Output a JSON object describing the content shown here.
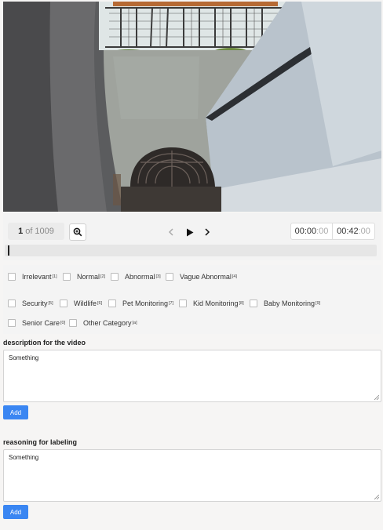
{
  "video": {
    "description_alt": ""
  },
  "player": {
    "current_frame": "1",
    "of_label": "of",
    "total_frames": "1009",
    "zoom_icon": "zoom-in-icon",
    "prev_icon": "chevron-left-icon",
    "play_icon": "play-icon",
    "next_icon": "chevron-right-icon",
    "current_time_main": "00:00",
    "current_time_sub": ":00",
    "duration_main": "00:42",
    "duration_sub": ":00",
    "progress": 0.0
  },
  "categories": [
    {
      "label": "Irrelevant",
      "key": "[1]"
    },
    {
      "label": "Normal",
      "key": "[2]"
    },
    {
      "label": "Abnormal",
      "key": "[3]"
    },
    {
      "label": "Vague Abnormal",
      "key": "[4]"
    },
    {
      "label": "Security",
      "key": "[5]"
    },
    {
      "label": "Wildlife",
      "key": "[6]"
    },
    {
      "label": "Pet Monitoring",
      "key": "[7]"
    },
    {
      "label": "Kid Monitoring",
      "key": "[8]"
    },
    {
      "label": "Baby Monitoring",
      "key": "[9]"
    },
    {
      "label": "Senior Care",
      "key": "[0]"
    },
    {
      "label": "Other Category",
      "key": "[a]"
    }
  ],
  "description": {
    "label": "description for the video",
    "value": "Something",
    "button": "Add"
  },
  "reasoning": {
    "label": "reasoning for labeling",
    "value": "Something",
    "button": "Add"
  },
  "colors": {
    "accent": "#3a86f2"
  }
}
